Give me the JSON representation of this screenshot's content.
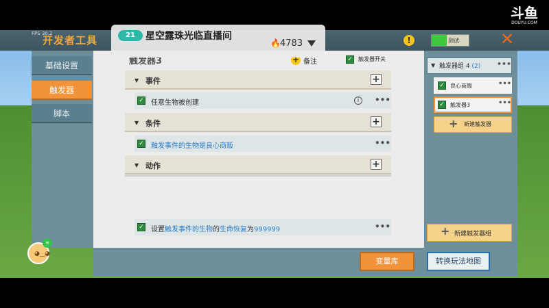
{
  "header": {
    "title": "开发者工具",
    "fps": "FPS 30.2",
    "test_label": "测试"
  },
  "stream": {
    "level": "21",
    "room_title": "星空露珠光临直播间",
    "viewers": "4783"
  },
  "logo": {
    "main": "斗鱼",
    "sub": "DOUYU.COM"
  },
  "sidebar": {
    "items": [
      {
        "label": "基础设置"
      },
      {
        "label": "触发器"
      },
      {
        "label": "脚本"
      }
    ]
  },
  "panel": {
    "title": "触发器3",
    "note_label": "备注",
    "switch_label": "触发器开关"
  },
  "sections": {
    "event": {
      "label": "事件",
      "row": {
        "text": "任意生物被创建"
      }
    },
    "condition": {
      "label": "条件",
      "row": {
        "prefix": "触发事件的生物是",
        "value": "良心商贩"
      }
    },
    "action": {
      "label": "动作",
      "row": {
        "p1": "设置",
        "h1": "触发事件的生物",
        "p2": "的",
        "h2": "生命恢复",
        "p3": "为",
        "h3": "999999"
      }
    }
  },
  "right_panel": {
    "group": {
      "label": "触发器组 4",
      "count": "(2)"
    },
    "triggers": [
      {
        "label": "良心商贩"
      },
      {
        "label": "触发器3"
      }
    ],
    "new_trigger_label": "新建触发器",
    "new_group_label": "新建触发器组"
  },
  "bottom": {
    "var_label": "变量库",
    "convert_label": "转换玩法地图"
  },
  "icons": {
    "warning": "warning-icon",
    "close": "close-icon",
    "plus": "plus-icon",
    "dots": "more-icon",
    "info": "info-icon"
  },
  "colors": {
    "accent_orange": "#f0933a",
    "check_green": "#2d8a3e",
    "link_blue": "#2b7ec7"
  }
}
